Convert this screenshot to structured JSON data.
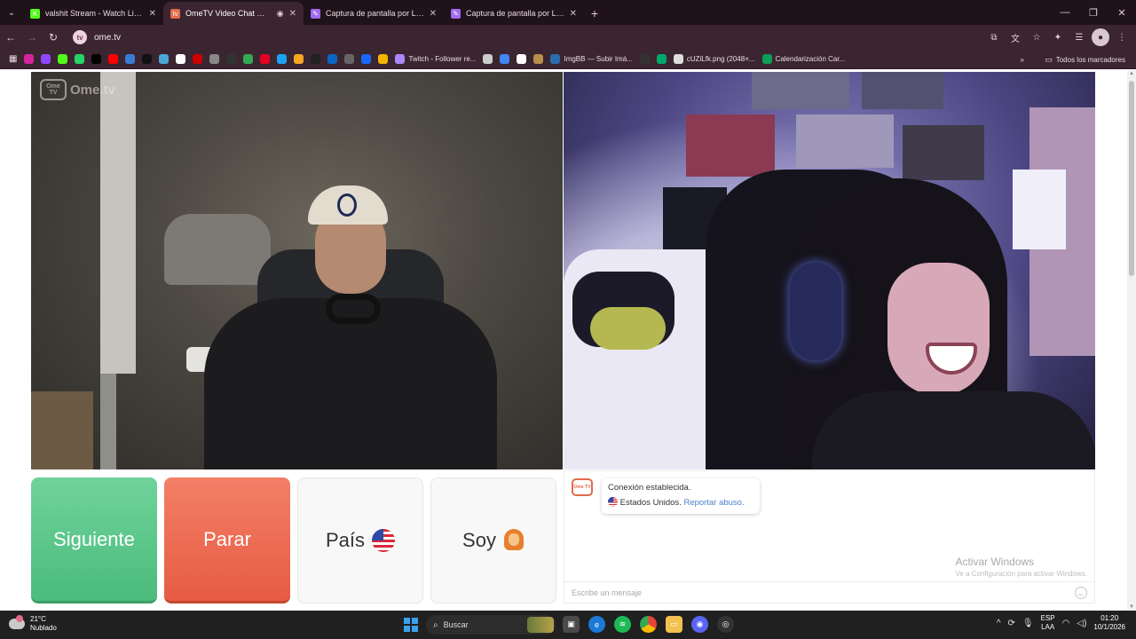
{
  "browser": {
    "tabs": [
      {
        "title": "valshit Stream - Watch Live on",
        "fav_color": "#53fc18",
        "fav_glyph": "K",
        "active": false
      },
      {
        "title": "OmeTV Video Chat — Ome",
        "fav_color": "#e26b4c",
        "fav_glyph": "tv",
        "active": true
      },
      {
        "title": "Captura de pantalla por Lightsh",
        "fav_color": "#a06bf0",
        "fav_glyph": "✎",
        "active": false
      },
      {
        "title": "Captura de pantalla por Lightsh",
        "fav_color": "#a06bf0",
        "fav_glyph": "✎",
        "active": false
      }
    ],
    "url": "ome.tv",
    "bookmarks": [
      {
        "label": "",
        "color": "#d6249f",
        "icon": "instagram-icon"
      },
      {
        "label": "",
        "color": "#9146ff",
        "icon": "twitch-icon"
      },
      {
        "label": "",
        "color": "#53fc18",
        "icon": "kick-icon"
      },
      {
        "label": "",
        "color": "#25d366",
        "icon": "whatsapp-icon"
      },
      {
        "label": "",
        "color": "#000000",
        "icon": "x-icon"
      },
      {
        "label": "",
        "color": "#ff0000",
        "icon": "youtube-icon"
      },
      {
        "label": "",
        "color": "#3a7bd5",
        "icon": "cloud-icon"
      },
      {
        "label": "",
        "color": "#111111",
        "icon": "tiktok-icon"
      },
      {
        "label": "",
        "color": "#4aa8d8",
        "icon": "bird-icon"
      },
      {
        "label": "",
        "color": "#ffffff",
        "icon": "google-icon"
      },
      {
        "label": "",
        "color": "#cc0000",
        "icon": "pinterest-icon"
      },
      {
        "label": "",
        "color": "#888888",
        "icon": "gear-icon"
      },
      {
        "label": "",
        "color": "#333333",
        "icon": "upwork-icon"
      },
      {
        "label": "",
        "color": "#34a853",
        "icon": "drive-icon"
      },
      {
        "label": "",
        "color": "#e60023",
        "icon": "pinterest-icon"
      },
      {
        "label": "",
        "color": "#1da1f2",
        "icon": "canva-icon"
      },
      {
        "label": "",
        "color": "#f5a623",
        "icon": "stack-icon"
      },
      {
        "label": "",
        "color": "#222222",
        "icon": "up-icon"
      },
      {
        "label": "",
        "color": "#0a66c2",
        "icon": "linkedin-icon"
      },
      {
        "label": "",
        "color": "#666666",
        "icon": "globe-icon"
      },
      {
        "label": "",
        "color": "#1769ff",
        "icon": "behance-icon"
      },
      {
        "label": "",
        "color": "#f4b400",
        "icon": "photo-icon"
      },
      {
        "label": "Twitch - Follower re...",
        "color": "#aa88ff",
        "icon": "sparkle-icon"
      },
      {
        "label": "",
        "color": "#cccccc",
        "icon": "dash-icon"
      },
      {
        "label": "",
        "color": "#4285f4",
        "icon": "doc-icon"
      },
      {
        "label": "",
        "color": "#ffffff",
        "icon": "google-icon"
      },
      {
        "label": "",
        "color": "#b98e4a",
        "icon": "box-icon"
      },
      {
        "label": "ImgBB — Subir Imá...",
        "color": "#2b6cb0",
        "icon": "imgbb-icon"
      },
      {
        "label": "",
        "color": "#333333",
        "icon": "notion-icon"
      },
      {
        "label": "",
        "color": "#00a86b",
        "icon": "leaf-icon"
      },
      {
        "label": "cUZiLfk.png (2048×...",
        "color": "#dddddd",
        "icon": "image-icon"
      },
      {
        "label": "Calendarización Car...",
        "color": "#0f9d58",
        "icon": "sheets-icon"
      }
    ],
    "all_bookmarks": "Todos los marcadores"
  },
  "app": {
    "logo_text": "Ome.tv",
    "logo_tv": "Ome TV"
  },
  "controls": {
    "next": "Siguiente",
    "stop": "Parar",
    "country": "País",
    "gender": "Soy"
  },
  "chat": {
    "connected": "Conexión establecida.",
    "country": "Estados Unidos.",
    "report": "Reportar abuso.",
    "placeholder": "Escribe un mensaje",
    "watermark_title": "Activar Windows",
    "watermark_sub": "Ve a Configuración para activar Windows."
  },
  "taskbar": {
    "temp": "21°C",
    "weather": "Nublado",
    "search": "Buscar",
    "lang1": "ESP",
    "lang2": "LAA",
    "time": "01:20",
    "date": "10/1/2026"
  },
  "colors": {
    "next": "#4cbb7d",
    "stop": "#e65c43",
    "chrome": "#3b2530"
  }
}
